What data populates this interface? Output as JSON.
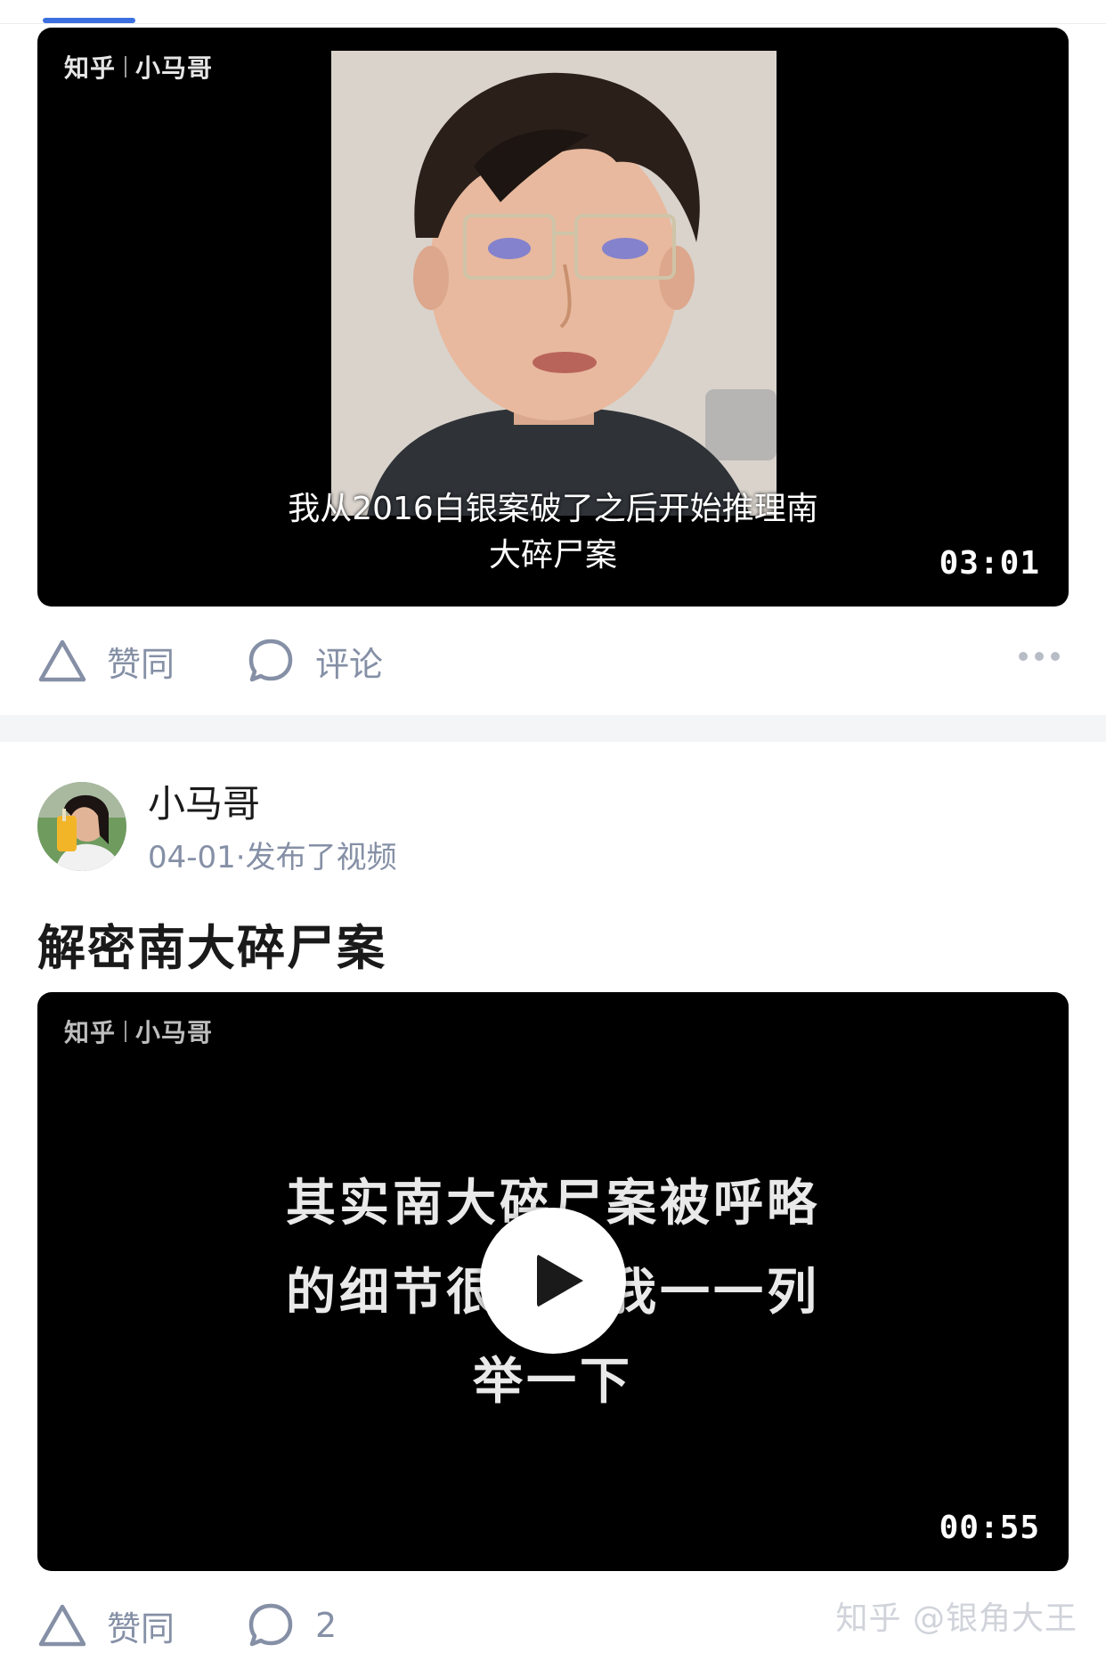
{
  "feed": {
    "post1": {
      "video": {
        "watermark_brand": "知乎",
        "watermark_author": "小马哥",
        "subtitle_line1": "我从2016白银案破了之后开始推理南",
        "subtitle_line2": "大碎尸案",
        "duration": "03:01"
      },
      "actions": {
        "like_label": "赞同",
        "comment_label": "评论"
      }
    },
    "post2": {
      "author_name": "小马哥",
      "meta": "04-01·发布了视频",
      "title": "解密南大碎尸案",
      "video": {
        "watermark_brand": "知乎",
        "watermark_author": "小马哥",
        "caption_line1": "其实南大碎尸案被呼略",
        "caption_line2": "的细节很多，我一一列",
        "caption_line3": "举一下",
        "duration": "00:55"
      },
      "actions": {
        "like_label": "赞同",
        "comment_count": "2"
      }
    }
  },
  "page_watermark": "知乎 @银角大王",
  "colors": {
    "accent_blue": "#3b6fe0",
    "muted_text": "#8590a6",
    "video_bg": "#000000"
  }
}
